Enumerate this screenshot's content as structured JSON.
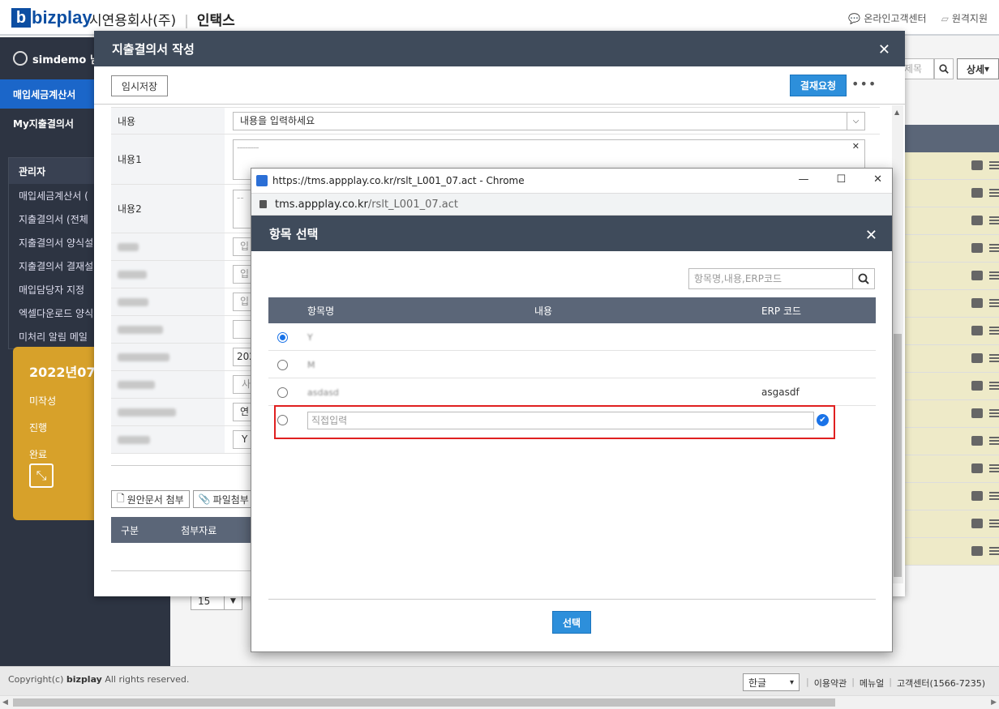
{
  "header": {
    "logo_text": "bizplay",
    "company": "시연용회사(주)",
    "service": "인택스",
    "links": [
      "온라인고객센터",
      "원격지원"
    ]
  },
  "sidebar": {
    "user": "simdemo 님",
    "menu": [
      "매입세금계산서",
      "My지출결의서"
    ],
    "admin_title": "관리자",
    "admin_items": [
      "매입세금계산서 (",
      "지출결의서 (전체",
      "지출결의서 양식설",
      "지출결의서 결재설",
      "매입담당자 지정",
      "엑셀다운로드 양식",
      "미처리 알림 메일"
    ],
    "month_card": {
      "title": "2022년07월",
      "rows": [
        "미작성",
        "진행",
        "완료"
      ]
    }
  },
  "main": {
    "search_placeholder": "제목",
    "detail_btn": "상세",
    "page_size": "15"
  },
  "modal": {
    "title": "지출결의서 작성",
    "draft_btn": "임시저장",
    "approve_btn": "결재요청",
    "more": "•••",
    "fields": {
      "content_label": "내용",
      "content_placeholder": "내용을 입력하세요",
      "content1_label": "내용1",
      "content2_label": "내용2",
      "partial_input_1": "입",
      "partial_input_2": "입",
      "partial_input_3": "입",
      "partial_year": "202",
      "partial_sa": "사",
      "partial_yeon": "연",
      "partial_y": "Y"
    },
    "attach_buttons": [
      "원안문서 첨부",
      "파일첨부"
    ],
    "attach_headers": [
      "구분",
      "첨부자료"
    ]
  },
  "popup": {
    "window_title": "https://tms.appplay.co.kr/rslt_L001_07.act - Chrome",
    "url_host": "tms.appplay.co.kr",
    "url_path": "/rslt_L001_07.act",
    "header_title": "항목 선택",
    "search_placeholder": "항목명,내용,ERP코드",
    "columns": [
      "항목명",
      "내용",
      "ERP 코드"
    ],
    "rows": [
      {
        "name": "Y",
        "erp": "",
        "selected": true
      },
      {
        "name": "M",
        "erp": "",
        "selected": false
      },
      {
        "name": "asdasd",
        "erp": "asgasdf",
        "selected": false
      }
    ],
    "direct_input_placeholder": "직접입력",
    "select_btn": "선택"
  },
  "footer": {
    "copyright_prefix": "Copyright(c) ",
    "copyright_brand": "bizplay",
    "copyright_suffix": " All rights reserved.",
    "lang": "한글",
    "links": [
      "이용약관",
      "메뉴얼",
      "고객센터(1566-7235)"
    ]
  },
  "colors": {
    "header_dark": "#3f4b5b",
    "accent_blue": "#2d8fdb",
    "sidebar_bg": "#2d3442",
    "card_gold": "#d7a12a",
    "highlight_red": "#e02020"
  }
}
